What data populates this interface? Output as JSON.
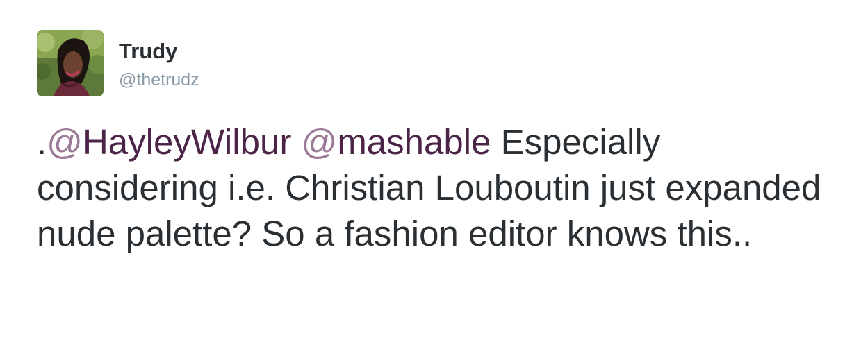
{
  "user": {
    "display_name": "Trudy",
    "handle": "@thetrudz"
  },
  "tweet": {
    "prefix": ".",
    "mention_1_at": "@",
    "mention_1_name": "HayleyWilbur",
    "mention_2_at": "@",
    "mention_2_name": "mashable",
    "body": " Especially considering i.e. Christian Louboutin just expanded nude palette? So a fashion editor knows this.."
  },
  "colors": {
    "text": "#292f33",
    "handle": "#8899a6",
    "mention": "#4b2447",
    "mention_at": "#9b7a98"
  }
}
